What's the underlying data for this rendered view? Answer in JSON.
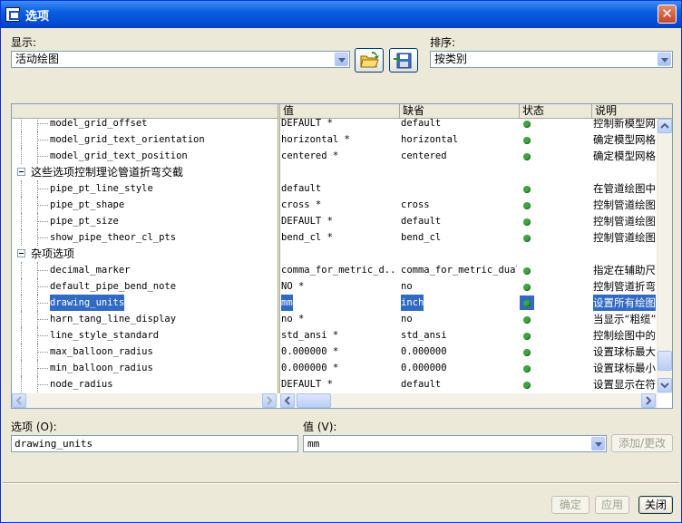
{
  "window": {
    "title": "选项",
    "close_glyph": "✕"
  },
  "display": {
    "label": "显示:",
    "value": "活动绘图"
  },
  "sort": {
    "label": "排序:",
    "value": "按类别"
  },
  "columns": {
    "name": "",
    "value": "值",
    "default": "缺省",
    "status": "状态",
    "desc": "说明"
  },
  "rows": [
    {
      "type": "item",
      "name": "model_grid_offset",
      "value": "DEFAULT *",
      "default": "default",
      "desc": "控制新模型网"
    },
    {
      "type": "item",
      "name": "model_grid_text_orientation",
      "value": "horizontal *",
      "default": "horizontal",
      "desc": "确定模型网格"
    },
    {
      "type": "item",
      "name": "model_grid_text_position",
      "value": "centered *",
      "default": "centered",
      "desc": "确定模型网格"
    },
    {
      "type": "group",
      "name": "这些选项控制理论管道折弯交截"
    },
    {
      "type": "item",
      "name": "pipe_pt_line_style",
      "value": "default",
      "default": "",
      "desc": "在管道绘图中"
    },
    {
      "type": "item",
      "name": "pipe_pt_shape",
      "value": "cross *",
      "default": "cross",
      "desc": "控制管道绘图"
    },
    {
      "type": "item",
      "name": "pipe_pt_size",
      "value": "DEFAULT *",
      "default": "default",
      "desc": "控制管道绘图"
    },
    {
      "type": "item",
      "name": "show_pipe_theor_cl_pts",
      "value": "bend_cl *",
      "default": "bend_cl",
      "desc": "控制管道绘图"
    },
    {
      "type": "group",
      "name": "杂项选项"
    },
    {
      "type": "item",
      "name": "decimal_marker",
      "value": "comma_for_metric_d...",
      "default": "comma_for_metric_dual",
      "desc": "指定在辅助尺"
    },
    {
      "type": "item",
      "name": "default_pipe_bend_note",
      "value": "NO *",
      "default": "no",
      "desc": "控制管道折弯"
    },
    {
      "type": "item",
      "name": "drawing_units",
      "value": "mm",
      "default": "inch",
      "desc": "设置所有绘图",
      "selected": true
    },
    {
      "type": "item",
      "name": "harn_tang_line_display",
      "value": "no *",
      "default": "no",
      "desc": "当显示“粗缆”"
    },
    {
      "type": "item",
      "name": "line_style_standard",
      "value": "std_ansi *",
      "default": "std_ansi",
      "desc": "控制绘图中的"
    },
    {
      "type": "item",
      "name": "max_balloon_radius",
      "value": "0.000000 *",
      "default": "0.000000",
      "desc": "设置球标最大"
    },
    {
      "type": "item",
      "name": "min_balloon_radius",
      "value": "0.000000 *",
      "default": "0.000000",
      "desc": "设置球标最小"
    },
    {
      "type": "item",
      "name": "node_radius",
      "value": "DEFAULT *",
      "default": "default",
      "desc": "设置显示在符"
    }
  ],
  "option_field": {
    "label": "选项 (O):",
    "value": "drawing_units"
  },
  "value_field": {
    "label": "值 (V):",
    "value": "mm"
  },
  "buttons": {
    "add_change": "添加/更改",
    "ok": "确定",
    "apply": "应用",
    "close": "关闭"
  }
}
